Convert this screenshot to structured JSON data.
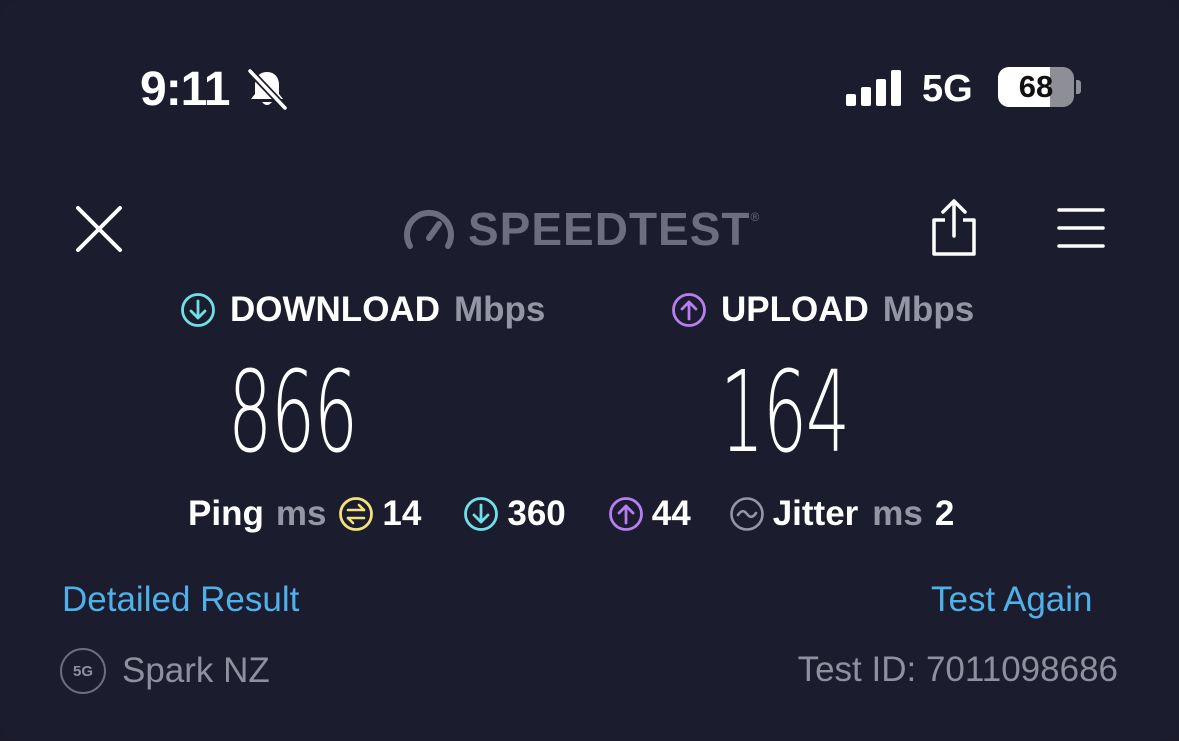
{
  "status_bar": {
    "time": "9:11",
    "network": "5G",
    "battery_level": "68",
    "battery_fraction": 0.68,
    "icons": [
      "bell-muted-icon",
      "cellular-signal-icon",
      "battery-icon"
    ]
  },
  "header": {
    "logo_text": "SPEEDTEST",
    "logo_tm": "®",
    "icons": [
      "close-icon",
      "speedometer-icon",
      "share-icon",
      "hamburger-menu-icon"
    ]
  },
  "download": {
    "label": "DOWNLOAD",
    "unit": "Mbps",
    "value": "866"
  },
  "upload": {
    "label": "UPLOAD",
    "unit": "Mbps",
    "value": "164"
  },
  "ping": {
    "label": "Ping",
    "unit": "ms",
    "idle": "14",
    "download": "360",
    "upload": "44"
  },
  "jitter": {
    "label": "Jitter",
    "unit": "ms",
    "value": "2"
  },
  "links": {
    "detailed": "Detailed Result",
    "again": "Test Again"
  },
  "provider": {
    "badge": "5G",
    "name": "Spark NZ"
  },
  "test_id": "Test ID: 7011098686",
  "colors": {
    "background": "#1b1c2d",
    "download_accent": "#6fe0e6",
    "upload_accent": "#b77ef0",
    "idle_accent": "#f1e27d",
    "link": "#4fb0ea",
    "muted": "#9596a4"
  }
}
